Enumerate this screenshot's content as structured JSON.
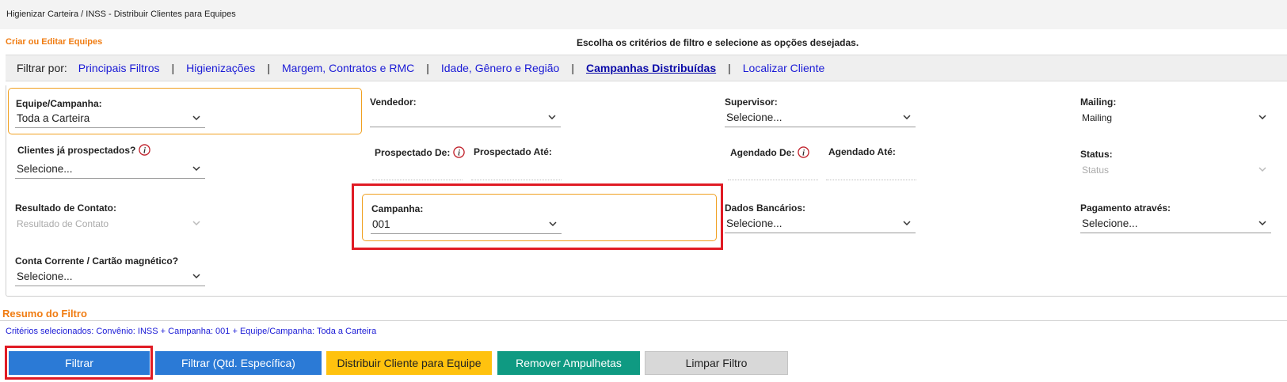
{
  "breadcrumb": "Higienizar Carteira / INSS - Distribuir Clientes para Equipes",
  "edit_teams_link": "Criar ou Editar Equipes",
  "instructions": "Escolha os critérios de filtro e selecione as opções desejadas.",
  "filter_bar": {
    "label": "Filtrar por:",
    "tabs": [
      {
        "label": "Principais Filtros",
        "active": false
      },
      {
        "label": "Higienizações",
        "active": false
      },
      {
        "label": "Margem, Contratos e RMC",
        "active": false
      },
      {
        "label": "Idade, Gênero e Região",
        "active": false
      },
      {
        "label": "Campanhas Distribuídas",
        "active": true
      },
      {
        "label": "Localizar Cliente",
        "active": false
      }
    ],
    "separator": "|"
  },
  "fields": {
    "equipe": {
      "label": "Equipe/Campanha:",
      "value": "Toda a Carteira"
    },
    "vendedor": {
      "label": "Vendedor:",
      "value": ""
    },
    "supervisor": {
      "label": "Supervisor:",
      "value": "Selecione..."
    },
    "mailing": {
      "label": "Mailing:",
      "value": "Mailing"
    },
    "clientes_prospectados": {
      "label": "Clientes já prospectados?",
      "value": "Selecione..."
    },
    "prospectado_de": {
      "label": "Prospectado De:"
    },
    "prospectado_ate": {
      "label": "Prospectado Até:"
    },
    "agendado_de": {
      "label": "Agendado De:"
    },
    "agendado_ate": {
      "label": "Agendado Até:"
    },
    "status": {
      "label": "Status:",
      "value": "Status"
    },
    "resultado_contato": {
      "label": "Resultado de Contato:",
      "value": "Resultado de Contato"
    },
    "campanha": {
      "label": "Campanha:",
      "value": "001"
    },
    "dados_bancarios": {
      "label": "Dados Bancários:",
      "value": "Selecione..."
    },
    "pagamento": {
      "label": "Pagamento através:",
      "value": "Selecione..."
    },
    "conta_corrente": {
      "label": "Conta Corrente / Cartão magnético?",
      "value": "Selecione..."
    }
  },
  "resumo": {
    "title": "Resumo do Filtro",
    "criteria": "Critérios selecionados: Convênio: INSS + Campanha: 001 + Equipe/Campanha: Toda a Carteira"
  },
  "buttons": {
    "filtrar": "Filtrar",
    "filtrar_qtd": "Filtrar (Qtd. Específica)",
    "distribuir": "Distribuir Cliente para Equipe",
    "remover": "Remover Ampulhetas",
    "limpar": "Limpar Filtro"
  },
  "colors": {
    "accent_orange": "#f07c12",
    "link_blue": "#1a1ad6",
    "highlight_red": "#e01b24",
    "button_blue": "#2b7ad6",
    "button_yellow": "#ffc20e",
    "button_teal": "#0f9a82",
    "button_gray": "#d8d8d8"
  },
  "icons": {
    "dropdown": "chevron-down-icon",
    "info": "info-icon"
  }
}
